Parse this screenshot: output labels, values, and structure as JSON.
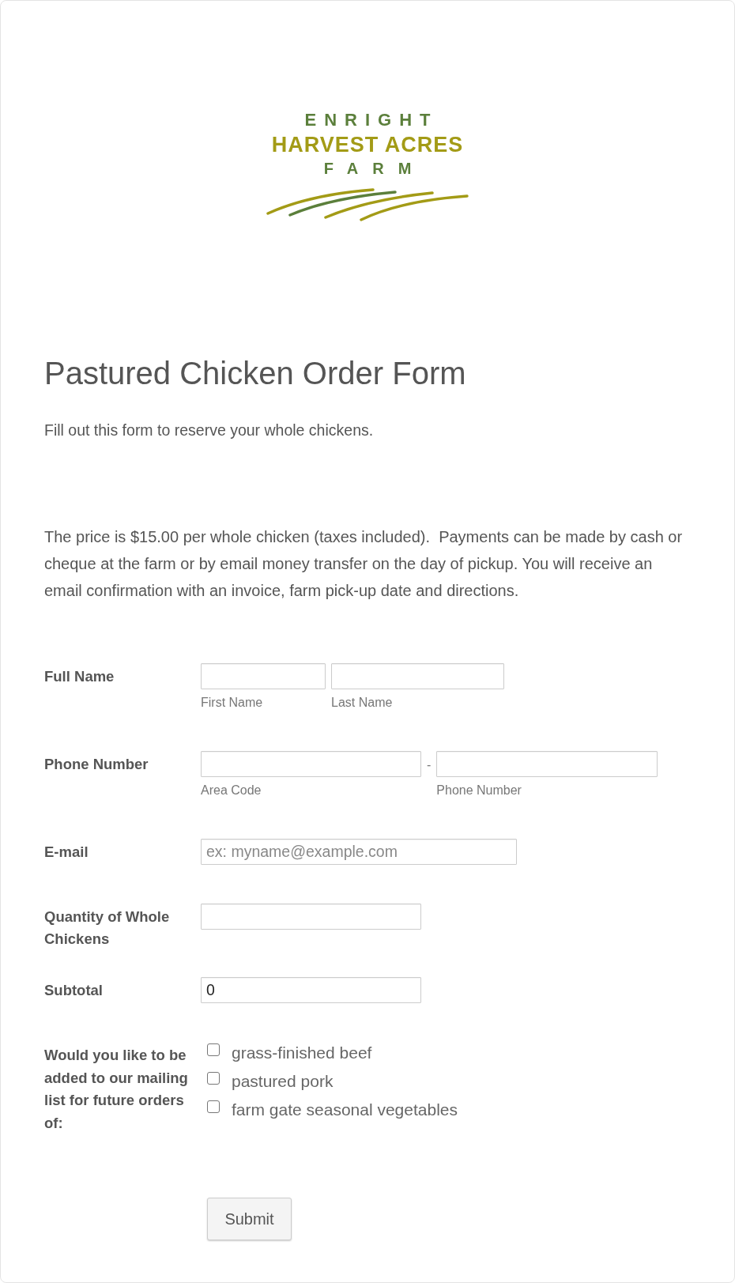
{
  "logo": {
    "top": "ENRIGHT",
    "middle": "HARVEST ACRES",
    "bottom": "FARM"
  },
  "title": "Pastured Chicken Order Form",
  "subtitle": "Fill out this form to reserve your whole chickens.",
  "description": "The price is $15.00 per whole chicken (taxes included).  Payments can be made by cash or cheque at the farm or by email money transfer on the day of pickup. You will receive an email confirmation with an invoice, farm pick-up date and directions.",
  "fields": [
    {
      "kind": "name",
      "label": "Full Name",
      "inputs": [
        {
          "sublabel": "First Name"
        },
        {
          "sublabel": "Last Name"
        }
      ]
    },
    {
      "kind": "phone",
      "label": "Phone Number",
      "separator": "-",
      "inputs": [
        {
          "sublabel": "Area Code"
        },
        {
          "sublabel": "Phone Number"
        }
      ]
    },
    {
      "kind": "email",
      "label": "E-mail",
      "placeholder": "ex: myname@example.com"
    },
    {
      "kind": "number",
      "label": "Quantity of Whole Chickens"
    },
    {
      "kind": "number",
      "label": "Subtotal",
      "value": "0"
    },
    {
      "kind": "checkboxes",
      "label": "Would you like to be added to our mailing list for future orders of:",
      "options": [
        {
          "label": "grass-finished beef",
          "checked": false
        },
        {
          "label": "pastured pork",
          "checked": false
        },
        {
          "label": "farm gate seasonal vegetables",
          "checked": false
        }
      ]
    }
  ],
  "submit": "Submit"
}
